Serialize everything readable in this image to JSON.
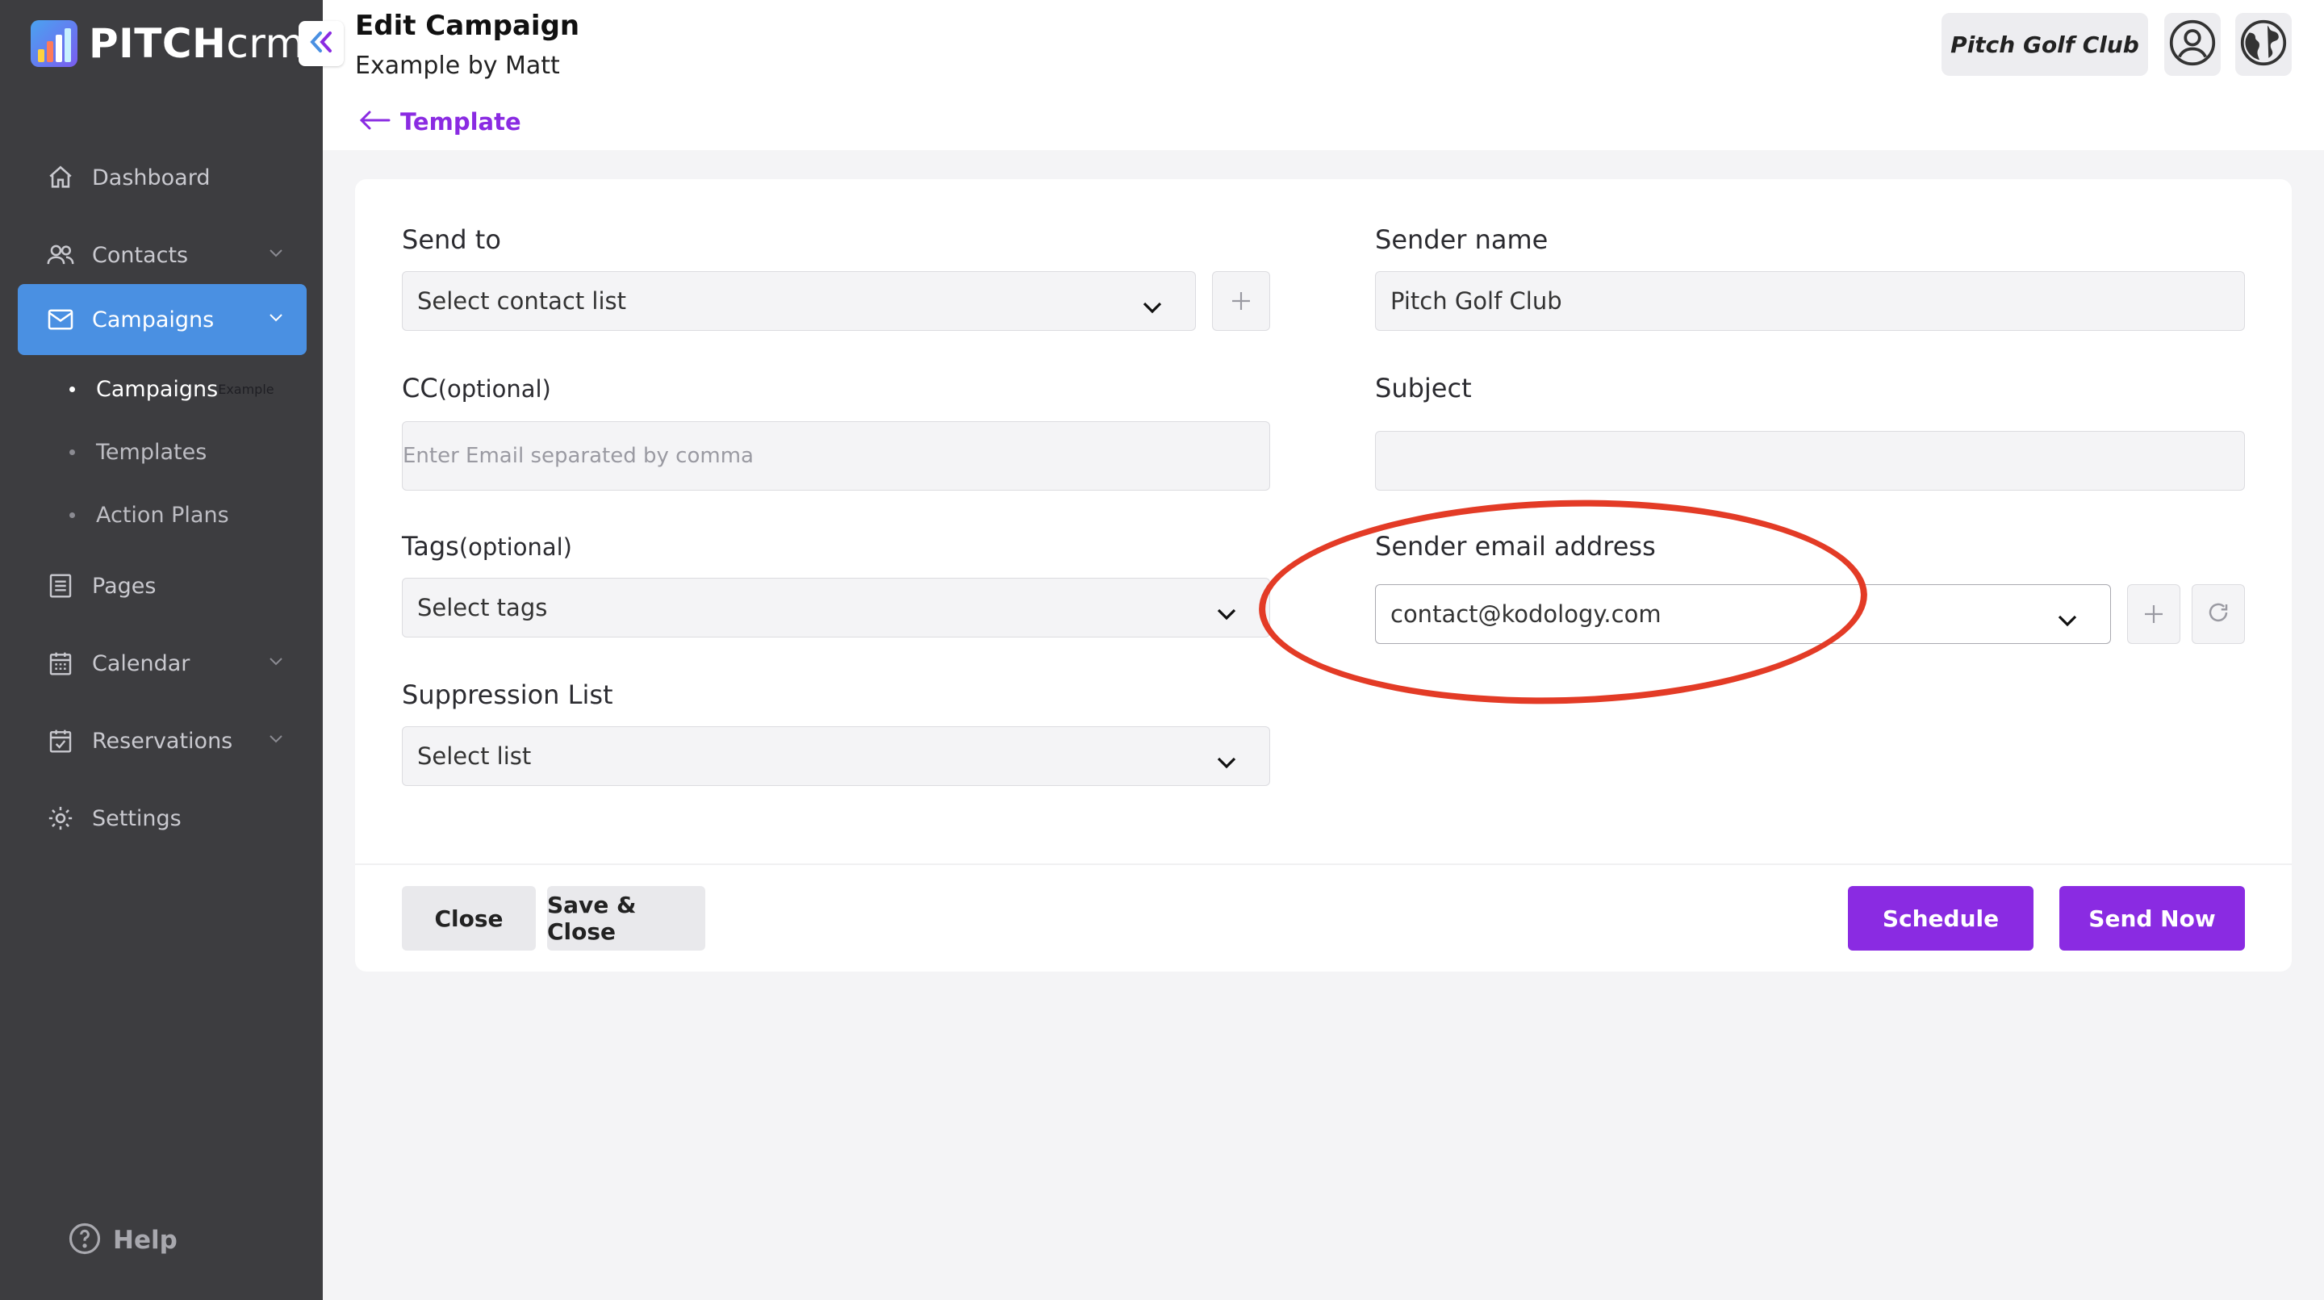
{
  "brand": {
    "name_bold": "PITCH",
    "name_light": "crm"
  },
  "nav": {
    "items": [
      {
        "label": "Dashboard"
      },
      {
        "label": "Contacts"
      },
      {
        "label": "Campaigns"
      },
      {
        "label": "Pages"
      },
      {
        "label": "Calendar"
      },
      {
        "label": "Reservations"
      },
      {
        "label": "Settings"
      }
    ],
    "sub_items": [
      {
        "label": "Campaigns"
      },
      {
        "label": "Templates"
      },
      {
        "label": "Action Plans"
      }
    ],
    "help": "Help"
  },
  "header": {
    "title": "Edit Campaign",
    "subtitle": "Example by Matt",
    "back_label": "Template",
    "club": "Pitch Golf Club"
  },
  "form": {
    "send_to": {
      "label": "Send to",
      "value": "Select contact list"
    },
    "cc": {
      "label": "CC",
      "optional": "(optional)",
      "placeholder": "Enter Email separated by comma"
    },
    "tags": {
      "label": "Tags",
      "optional": "(optional)",
      "value": "Select tags"
    },
    "suppression": {
      "label": "Suppression List",
      "value": "Select list"
    },
    "sender_name": {
      "label": "Sender name",
      "value": "Pitch Golf Club"
    },
    "subject": {
      "label": "Subject",
      "value": ""
    },
    "sender_email": {
      "label": "Sender email address",
      "value": "contact@kodology.com"
    }
  },
  "actions": {
    "close": "Close",
    "save_close": "Save & Close",
    "schedule": "Schedule",
    "send_now": "Send Now"
  },
  "colors": {
    "accent": "#8a2be2",
    "nav_active": "#4a90e2",
    "sidebar": "#3d3d40",
    "annotation": "#e33b26"
  }
}
